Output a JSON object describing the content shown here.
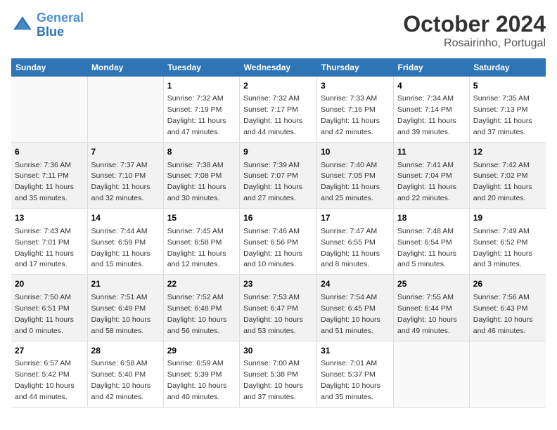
{
  "logo": {
    "line1": "General",
    "line2": "Blue"
  },
  "title": "October 2024",
  "subtitle": "Rosairinho, Portugal",
  "days_of_week": [
    "Sunday",
    "Monday",
    "Tuesday",
    "Wednesday",
    "Thursday",
    "Friday",
    "Saturday"
  ],
  "weeks": [
    [
      {
        "day": "",
        "sunrise": "",
        "sunset": "",
        "daylight": ""
      },
      {
        "day": "",
        "sunrise": "",
        "sunset": "",
        "daylight": ""
      },
      {
        "day": "1",
        "sunrise": "Sunrise: 7:32 AM",
        "sunset": "Sunset: 7:19 PM",
        "daylight": "Daylight: 11 hours and 47 minutes."
      },
      {
        "day": "2",
        "sunrise": "Sunrise: 7:32 AM",
        "sunset": "Sunset: 7:17 PM",
        "daylight": "Daylight: 11 hours and 44 minutes."
      },
      {
        "day": "3",
        "sunrise": "Sunrise: 7:33 AM",
        "sunset": "Sunset: 7:16 PM",
        "daylight": "Daylight: 11 hours and 42 minutes."
      },
      {
        "day": "4",
        "sunrise": "Sunrise: 7:34 AM",
        "sunset": "Sunset: 7:14 PM",
        "daylight": "Daylight: 11 hours and 39 minutes."
      },
      {
        "day": "5",
        "sunrise": "Sunrise: 7:35 AM",
        "sunset": "Sunset: 7:13 PM",
        "daylight": "Daylight: 11 hours and 37 minutes."
      }
    ],
    [
      {
        "day": "6",
        "sunrise": "Sunrise: 7:36 AM",
        "sunset": "Sunset: 7:11 PM",
        "daylight": "Daylight: 11 hours and 35 minutes."
      },
      {
        "day": "7",
        "sunrise": "Sunrise: 7:37 AM",
        "sunset": "Sunset: 7:10 PM",
        "daylight": "Daylight: 11 hours and 32 minutes."
      },
      {
        "day": "8",
        "sunrise": "Sunrise: 7:38 AM",
        "sunset": "Sunset: 7:08 PM",
        "daylight": "Daylight: 11 hours and 30 minutes."
      },
      {
        "day": "9",
        "sunrise": "Sunrise: 7:39 AM",
        "sunset": "Sunset: 7:07 PM",
        "daylight": "Daylight: 11 hours and 27 minutes."
      },
      {
        "day": "10",
        "sunrise": "Sunrise: 7:40 AM",
        "sunset": "Sunset: 7:05 PM",
        "daylight": "Daylight: 11 hours and 25 minutes."
      },
      {
        "day": "11",
        "sunrise": "Sunrise: 7:41 AM",
        "sunset": "Sunset: 7:04 PM",
        "daylight": "Daylight: 11 hours and 22 minutes."
      },
      {
        "day": "12",
        "sunrise": "Sunrise: 7:42 AM",
        "sunset": "Sunset: 7:02 PM",
        "daylight": "Daylight: 11 hours and 20 minutes."
      }
    ],
    [
      {
        "day": "13",
        "sunrise": "Sunrise: 7:43 AM",
        "sunset": "Sunset: 7:01 PM",
        "daylight": "Daylight: 11 hours and 17 minutes."
      },
      {
        "day": "14",
        "sunrise": "Sunrise: 7:44 AM",
        "sunset": "Sunset: 6:59 PM",
        "daylight": "Daylight: 11 hours and 15 minutes."
      },
      {
        "day": "15",
        "sunrise": "Sunrise: 7:45 AM",
        "sunset": "Sunset: 6:58 PM",
        "daylight": "Daylight: 11 hours and 12 minutes."
      },
      {
        "day": "16",
        "sunrise": "Sunrise: 7:46 AM",
        "sunset": "Sunset: 6:56 PM",
        "daylight": "Daylight: 11 hours and 10 minutes."
      },
      {
        "day": "17",
        "sunrise": "Sunrise: 7:47 AM",
        "sunset": "Sunset: 6:55 PM",
        "daylight": "Daylight: 11 hours and 8 minutes."
      },
      {
        "day": "18",
        "sunrise": "Sunrise: 7:48 AM",
        "sunset": "Sunset: 6:54 PM",
        "daylight": "Daylight: 11 hours and 5 minutes."
      },
      {
        "day": "19",
        "sunrise": "Sunrise: 7:49 AM",
        "sunset": "Sunset: 6:52 PM",
        "daylight": "Daylight: 11 hours and 3 minutes."
      }
    ],
    [
      {
        "day": "20",
        "sunrise": "Sunrise: 7:50 AM",
        "sunset": "Sunset: 6:51 PM",
        "daylight": "Daylight: 11 hours and 0 minutes."
      },
      {
        "day": "21",
        "sunrise": "Sunrise: 7:51 AM",
        "sunset": "Sunset: 6:49 PM",
        "daylight": "Daylight: 10 hours and 58 minutes."
      },
      {
        "day": "22",
        "sunrise": "Sunrise: 7:52 AM",
        "sunset": "Sunset: 6:48 PM",
        "daylight": "Daylight: 10 hours and 56 minutes."
      },
      {
        "day": "23",
        "sunrise": "Sunrise: 7:53 AM",
        "sunset": "Sunset: 6:47 PM",
        "daylight": "Daylight: 10 hours and 53 minutes."
      },
      {
        "day": "24",
        "sunrise": "Sunrise: 7:54 AM",
        "sunset": "Sunset: 6:45 PM",
        "daylight": "Daylight: 10 hours and 51 minutes."
      },
      {
        "day": "25",
        "sunrise": "Sunrise: 7:55 AM",
        "sunset": "Sunset: 6:44 PM",
        "daylight": "Daylight: 10 hours and 49 minutes."
      },
      {
        "day": "26",
        "sunrise": "Sunrise: 7:56 AM",
        "sunset": "Sunset: 6:43 PM",
        "daylight": "Daylight: 10 hours and 46 minutes."
      }
    ],
    [
      {
        "day": "27",
        "sunrise": "Sunrise: 6:57 AM",
        "sunset": "Sunset: 5:42 PM",
        "daylight": "Daylight: 10 hours and 44 minutes."
      },
      {
        "day": "28",
        "sunrise": "Sunrise: 6:58 AM",
        "sunset": "Sunset: 5:40 PM",
        "daylight": "Daylight: 10 hours and 42 minutes."
      },
      {
        "day": "29",
        "sunrise": "Sunrise: 6:59 AM",
        "sunset": "Sunset: 5:39 PM",
        "daylight": "Daylight: 10 hours and 40 minutes."
      },
      {
        "day": "30",
        "sunrise": "Sunrise: 7:00 AM",
        "sunset": "Sunset: 5:38 PM",
        "daylight": "Daylight: 10 hours and 37 minutes."
      },
      {
        "day": "31",
        "sunrise": "Sunrise: 7:01 AM",
        "sunset": "Sunset: 5:37 PM",
        "daylight": "Daylight: 10 hours and 35 minutes."
      },
      {
        "day": "",
        "sunrise": "",
        "sunset": "",
        "daylight": ""
      },
      {
        "day": "",
        "sunrise": "",
        "sunset": "",
        "daylight": ""
      }
    ]
  ]
}
